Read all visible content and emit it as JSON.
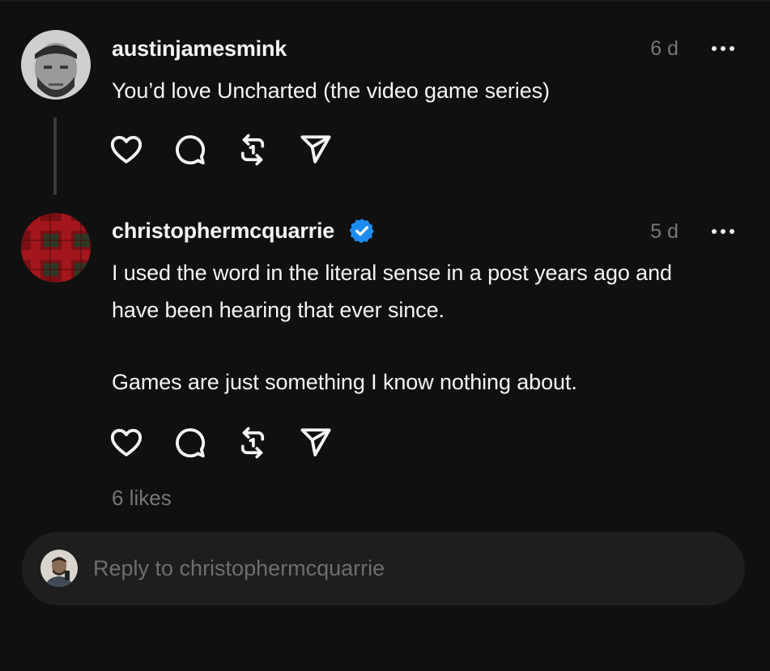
{
  "comments": [
    {
      "username": "austinjamesmink",
      "time": "6 d",
      "text": "You’d love Uncharted (the video game series)",
      "verified": false
    },
    {
      "username": "christophermcquarrie",
      "time": "5 d",
      "text_lines": [
        "I used the word in the literal sense in a post years ago and",
        "have been hearing that ever since."
      ],
      "text_paragraph2": "Games are just something I know nothing about.",
      "verified": true,
      "likes": "6 likes"
    }
  ],
  "reply": {
    "placeholder": "Reply to christophermcquarrie",
    "value": ""
  },
  "colors": {
    "background": "#101010",
    "text": "#f3f5f7",
    "muted": "#777777",
    "verified": "#0095f6",
    "reply_bar": "#1e1e1e"
  },
  "icons": [
    "heart-icon",
    "comment-icon",
    "repost-icon",
    "share-icon",
    "more-icon",
    "verified-badge-icon"
  ]
}
